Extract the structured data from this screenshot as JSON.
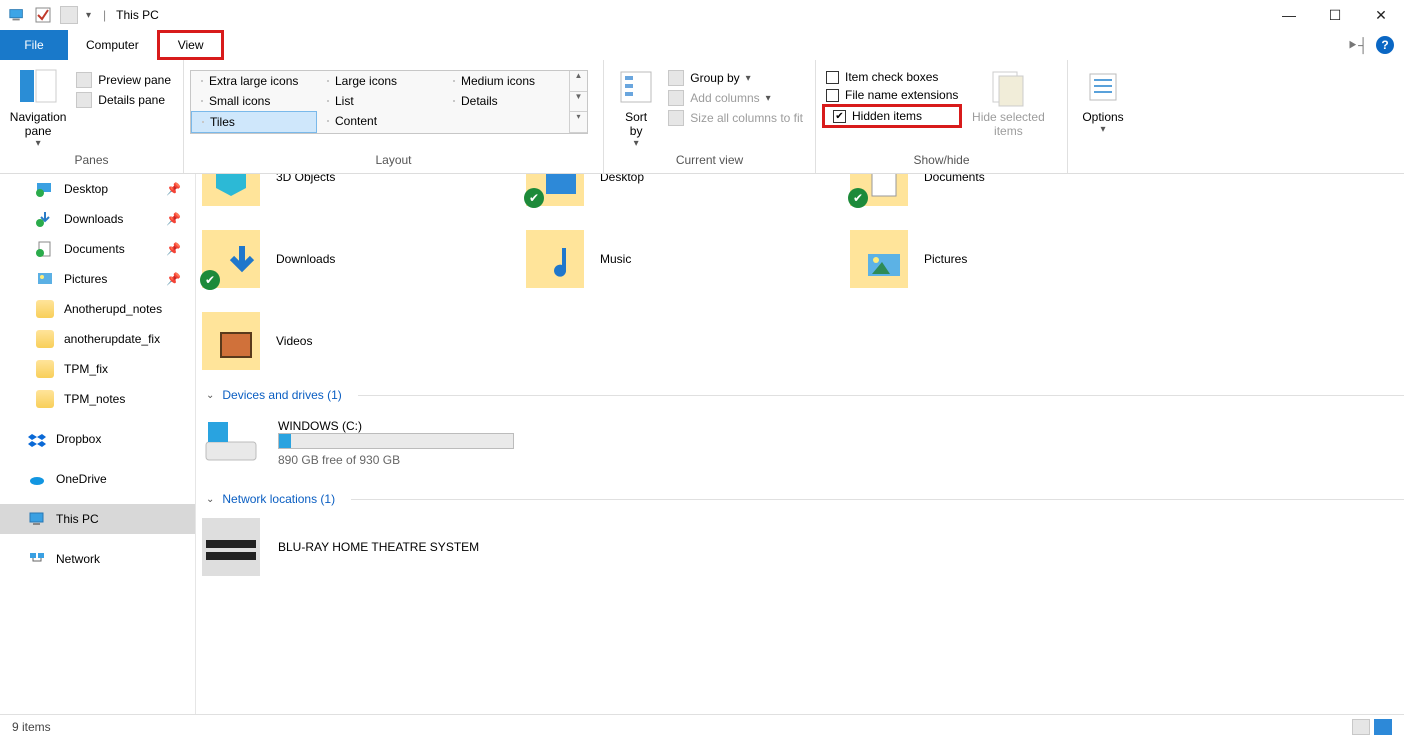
{
  "window": {
    "title": "This PC"
  },
  "tabs": {
    "file": "File",
    "computer": "Computer",
    "view": "View"
  },
  "ribbon": {
    "panes": {
      "nav": "Navigation\npane",
      "preview": "Preview pane",
      "details": "Details pane",
      "group": "Panes"
    },
    "layout": {
      "xl": "Extra large icons",
      "lg": "Large icons",
      "md": "Medium icons",
      "sm": "Small icons",
      "list": "List",
      "det": "Details",
      "tiles": "Tiles",
      "content": "Content",
      "group": "Layout"
    },
    "currentview": {
      "sortby": "Sort\nby",
      "groupby": "Group by",
      "addcols": "Add columns",
      "sizeall": "Size all columns to fit",
      "group": "Current view"
    },
    "showhide": {
      "itemcheck": "Item check boxes",
      "fileext": "File name extensions",
      "hidden": "Hidden items",
      "hideselected": "Hide selected\nitems",
      "group": "Show/hide"
    },
    "options": {
      "options": "Options"
    }
  },
  "sidebar": {
    "items": [
      {
        "name": "Desktop",
        "pinned": true,
        "icon": "desktop"
      },
      {
        "name": "Downloads",
        "pinned": true,
        "icon": "downloads"
      },
      {
        "name": "Documents",
        "pinned": true,
        "icon": "documents"
      },
      {
        "name": "Pictures",
        "pinned": true,
        "icon": "pictures"
      },
      {
        "name": "Anotherupd_notes",
        "pinned": false,
        "icon": "folder"
      },
      {
        "name": "anotherupdate_fix",
        "pinned": false,
        "icon": "folder"
      },
      {
        "name": "TPM_fix",
        "pinned": false,
        "icon": "folder"
      },
      {
        "name": "TPM_notes",
        "pinned": false,
        "icon": "folder"
      }
    ],
    "dropbox": "Dropbox",
    "onedrive": "OneDrive",
    "thispc": "This PC",
    "network": "Network"
  },
  "content": {
    "folders_top": [
      {
        "name": "3D Objects",
        "icon": "3d",
        "badge": false
      },
      {
        "name": "Desktop",
        "icon": "desktop",
        "badge": true
      },
      {
        "name": "Documents",
        "icon": "documents",
        "badge": true
      }
    ],
    "folders_mid": [
      {
        "name": "Downloads",
        "icon": "downloads",
        "badge": true
      },
      {
        "name": "Music",
        "icon": "music",
        "badge": false
      },
      {
        "name": "Pictures",
        "icon": "pictures",
        "badge": false
      }
    ],
    "folders_last": [
      {
        "name": "Videos",
        "icon": "videos",
        "badge": false
      }
    ],
    "devices_header": "Devices and drives (1)",
    "drive": {
      "name": "WINDOWS (C:)",
      "free_text": "890 GB free of 930 GB",
      "fill_pct": 5
    },
    "netloc_header": "Network locations (1)",
    "netloc_item": "BLU-RAY HOME THEATRE SYSTEM"
  },
  "status": {
    "items": "9 items"
  }
}
